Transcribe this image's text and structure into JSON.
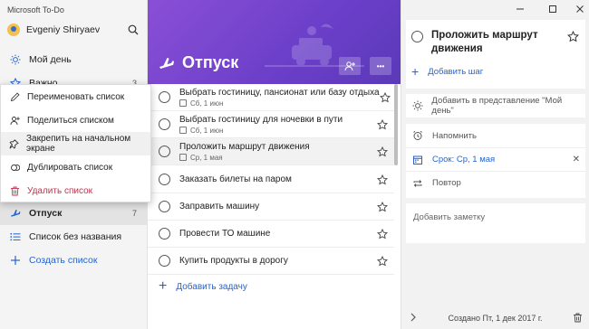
{
  "app": {
    "title": "Microsoft To-Do"
  },
  "user": {
    "name": "Evgeniy Shiryaev"
  },
  "sidebar": {
    "items": [
      {
        "label": "Мой день",
        "count": ""
      },
      {
        "label": "Важно",
        "count": "3"
      },
      {
        "label": "Отпуск",
        "count": "7"
      },
      {
        "label": "Список без названия",
        "count": ""
      },
      {
        "label": "Создать список",
        "count": ""
      }
    ]
  },
  "context_menu": {
    "items": [
      {
        "label": "Переименовать список"
      },
      {
        "label": "Поделиться списком"
      },
      {
        "label": "Закрепить на начальном экране"
      },
      {
        "label": "Дублировать список"
      },
      {
        "label": "Удалить список"
      }
    ]
  },
  "list": {
    "title": "Отпуск",
    "more_label": "•••",
    "tasks": [
      {
        "title": "Выбрать гостиницу, пансионат или базу отдыха",
        "meta": "Сб, 1 июн"
      },
      {
        "title": "Выбрать гостиницу для ночевки в пути",
        "meta": "Сб, 1 июн"
      },
      {
        "title": "Проложить маршрут движения",
        "meta": "Ср, 1 мая"
      },
      {
        "title": "Заказать билеты на паром",
        "meta": ""
      },
      {
        "title": "Заправить машину",
        "meta": ""
      },
      {
        "title": "Провести ТО машине",
        "meta": ""
      },
      {
        "title": "Купить продукты в дорогу",
        "meta": ""
      }
    ],
    "add_task_label": "Добавить задачу"
  },
  "detail": {
    "title": "Проложить маршрут движения",
    "add_step_label": "Добавить шаг",
    "my_day_label": "Добавить в представление \"Мой день\"",
    "remind_label": "Напомнить",
    "due_label": "Срок: Ср, 1 мая",
    "repeat_label": "Повтор",
    "note_placeholder": "Добавить заметку",
    "footer_text": "Создано Пт, 1 дек 2017 г."
  },
  "colors": {
    "accent": "#2564cf",
    "banner": "#7a47d0",
    "danger": "#c4314b"
  }
}
